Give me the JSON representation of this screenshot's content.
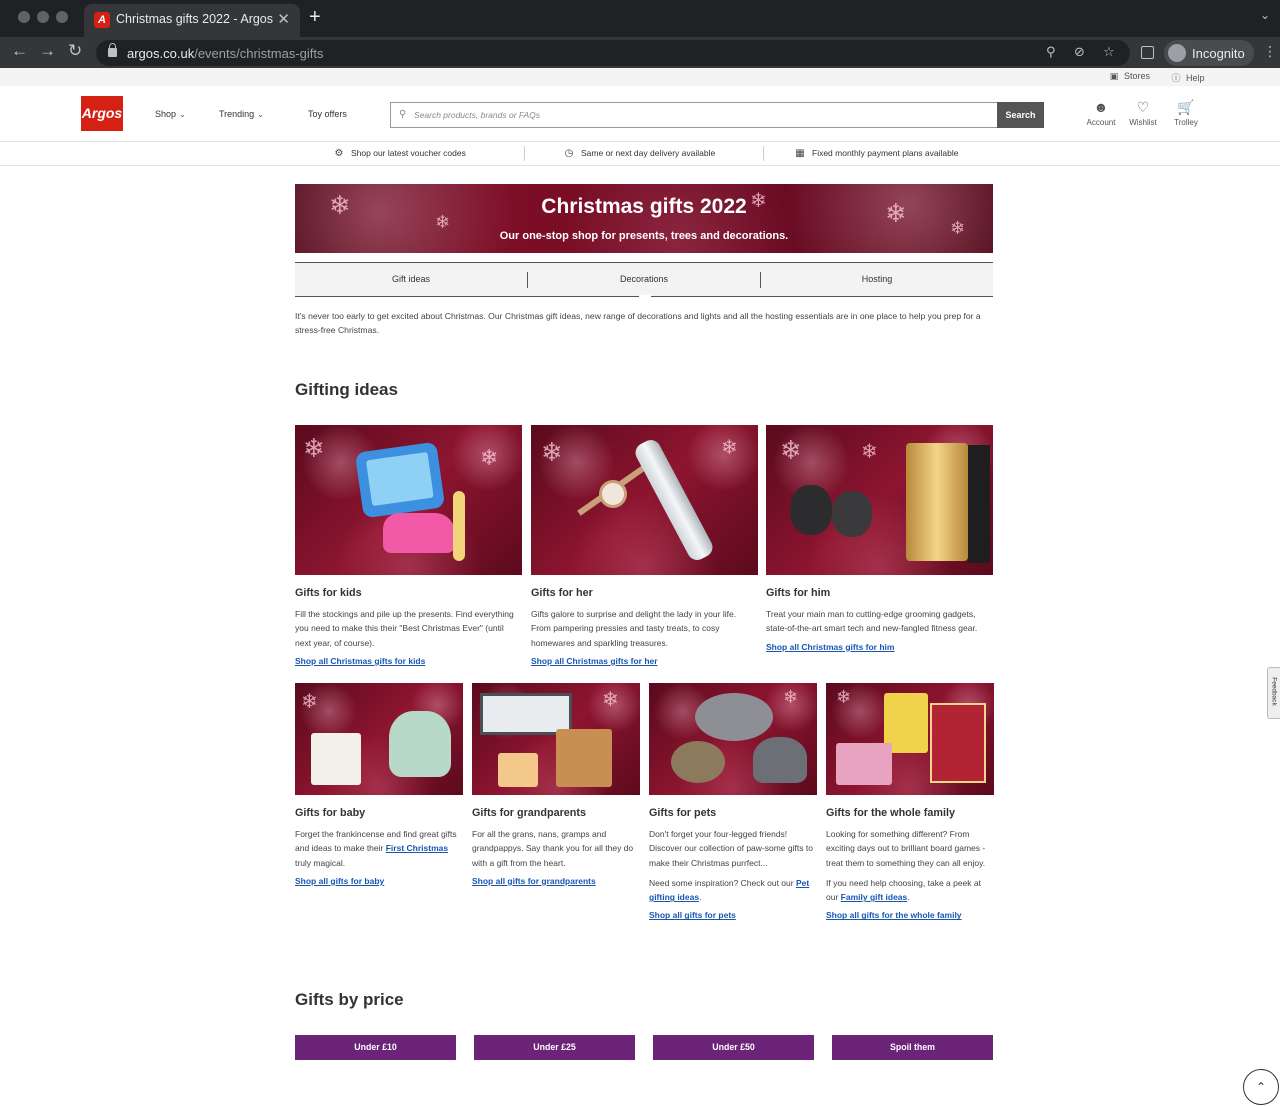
{
  "browser": {
    "tab_title": "Christmas gifts 2022 - Argos",
    "tab_close": "✕",
    "new_tab": "+",
    "url_domain": "argos.co.uk",
    "url_path": "/events/christmas-gifts",
    "incognito_label": "Incognito"
  },
  "utility": {
    "stores": "Stores",
    "help": "Help"
  },
  "header": {
    "logo_text": "Argos",
    "nav": [
      "Shop",
      "Trending",
      "Toy offers"
    ],
    "search_placeholder": "Search products, brands or FAQs",
    "search_button": "Search",
    "account": "Account",
    "wishlist": "Wishlist",
    "trolley": "Trolley"
  },
  "usp": [
    "Shop our latest voucher codes",
    "Same or next day delivery available",
    "Fixed monthly payment plans available"
  ],
  "hero": {
    "title": "Christmas gifts 2022",
    "subtitle": "Our one-stop shop for presents, trees and decorations."
  },
  "sub_tabs": [
    "Gift ideas",
    "Decorations",
    "Hosting"
  ],
  "intro": "It's never too early to get excited about Christmas. Our Christmas gift ideas, new range of decorations and lights and all the hosting essentials are in one place to help you prep for a stress-free Christmas.",
  "gifting": {
    "heading": "Gifting ideas",
    "kids": {
      "title": "Gifts for kids",
      "desc": "Fill the stockings and pile up the presents. Find everything you need to make this their \"Best Christmas Ever\" (until next year, of course).",
      "link": "Shop all Christmas gifts for kids"
    },
    "her": {
      "title": "Gifts for her",
      "desc": "Gifts galore to surprise and delight the lady in your life. From pampering pressies and tasty treats, to cosy homewares and sparkling treasures.",
      "link": "Shop all Christmas gifts for her"
    },
    "him": {
      "title": "Gifts for him",
      "desc": "Treat your main man to cutting-edge grooming gadgets, state-of-the-art smart tech and new-fangled fitness gear.",
      "link": "Shop all Christmas gifts for him"
    },
    "baby": {
      "title": "Gifts for baby",
      "desc_before": "Forget the frankincense and find great gifts and ideas to make their ",
      "desc_link": "First Christmas",
      "desc_after": " truly magical.",
      "link": "Shop all gifts for baby"
    },
    "grandparents": {
      "title": "Gifts for grandparents",
      "desc": "For all the grans, nans, gramps and grandpappys. Say thank you for all they do with a gift from the heart.",
      "link": "Shop all gifts for grandparents"
    },
    "pets": {
      "title": "Gifts for pets",
      "desc": "Don't forget your four-legged friends! Discover our collection of paw-some gifts to make their Christmas purrfect...",
      "desc2_before": "Need some inspiration? Check out our ",
      "desc2_link": "Pet gifting ideas",
      "desc2_after": ".",
      "link": "Shop all gifts for pets"
    },
    "family": {
      "title": "Gifts for the whole family",
      "desc": "Looking for something different? From exciting days out to brilliant board games - treat them to something they can all enjoy.",
      "desc2_before": "If you need help choosing, take a peek at our ",
      "desc2_link": "Family gift ideas",
      "desc2_after": ".",
      "link": "Shop all gifts for the whole family"
    }
  },
  "price": {
    "heading": "Gifts by price",
    "buttons": [
      "Under £10",
      "Under £25",
      "Under £50",
      "Spoil them"
    ]
  },
  "feedback_label": "Feedback",
  "colors": {
    "argos_red": "#d42114",
    "price_purple": "#6b2478",
    "link_blue": "#1a56b0"
  }
}
